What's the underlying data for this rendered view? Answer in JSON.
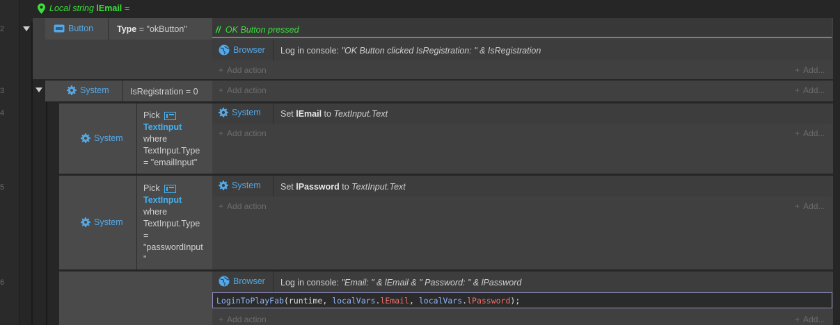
{
  "local_var": {
    "prefix": "Local string",
    "name": "lEmail",
    "suffix": "="
  },
  "line_numbers": [
    "2",
    "3",
    "4",
    "5",
    "6"
  ],
  "event_block": {
    "object": "Button",
    "condition_param": "Type",
    "condition_value": "= \"okButton\"",
    "comment_mark": "//",
    "comment_text": "OK Button pressed",
    "actions": [
      {
        "object": "Browser",
        "text_plain": "Log in console: ",
        "text_italic": "\"OK Button clicked IsRegistration: \" & IsRegistration"
      }
    ],
    "add_action": "Add action",
    "add_right": "Add..."
  },
  "sub_event": {
    "object": "System",
    "condition": "IsRegistration = 0",
    "add_action": "Add action",
    "add_right": "Add..."
  },
  "pick_email": {
    "object": "System",
    "pick_lines": [
      "Pick",
      "TextInput",
      "where",
      "TextInput.Type",
      "= \"emailInput\""
    ],
    "action_object": "System",
    "action_plain": "Set ",
    "action_bold": "lEmail",
    "action_to": " to ",
    "action_italic": "TextInput.Text",
    "add_action": "Add action",
    "add_right": "Add..."
  },
  "pick_password": {
    "object": "System",
    "pick_lines": [
      "Pick",
      "TextInput",
      "where",
      "TextInput.Type",
      "=",
      "\"passwordInput",
      "\""
    ],
    "action_object": "System",
    "action_plain": "Set ",
    "action_bold": "lPassword",
    "action_to": " to ",
    "action_italic": "TextInput.Text",
    "add_action": "Add action",
    "add_right": "Add..."
  },
  "final_block": {
    "action_object": "Browser",
    "action_plain": "Log in console: ",
    "action_italic": "\"Email: \" & lEmail & \" Password: \" & lPassword",
    "code": {
      "fn": "LoginToPlayFab",
      "p1": "(runtime, ",
      "o1": "localVars",
      "d1": ".",
      "v1": "lEmail",
      "p2": ", ",
      "o2": "localVars",
      "d2": ".",
      "v2": "lPassword",
      "p3": ");"
    },
    "add_action": "Add action",
    "add_right": "Add..."
  },
  "colors": {
    "system_blue": "#55a8e6",
    "comment_green": "#39e03a",
    "code_border": "#8e8ec4"
  },
  "icons": [
    "map-pin-icon",
    "button-object-icon",
    "gear-icon",
    "globe-icon",
    "textinput-object-icon",
    "collapse-triangle-icon",
    "plus-icon"
  ]
}
